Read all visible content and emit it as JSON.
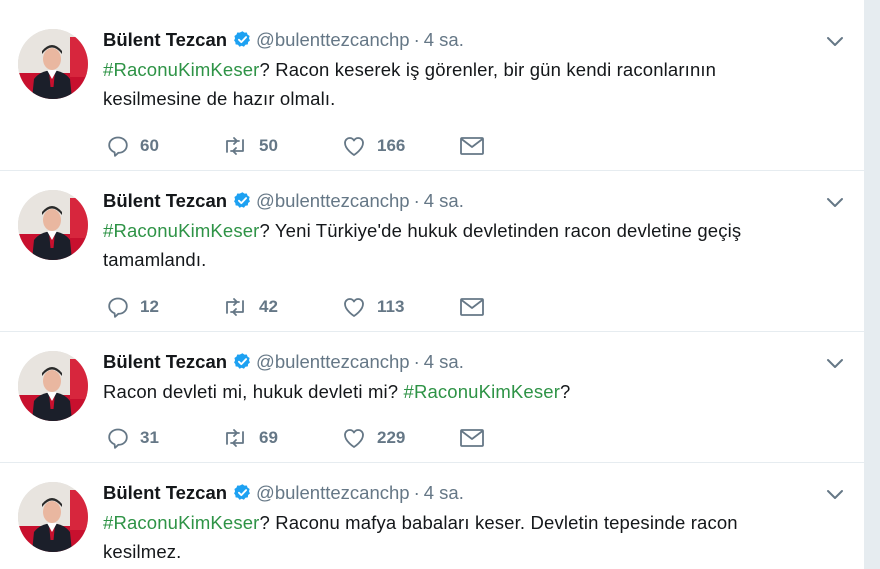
{
  "tweets": [
    {
      "name": "Bülent Tezcan",
      "handle": "@bulenttezcanchp",
      "separator": "·",
      "time": "4 sa.",
      "segments": [
        {
          "text": "#RaconuKimKeser",
          "hashtag": true
        },
        {
          "text": "? Racon keserek iş görenler, bir gün kendi raconlarının kesilmesine de hazır olmalı.",
          "hashtag": false
        }
      ],
      "replies": "60",
      "retweets": "50",
      "likes": "166"
    },
    {
      "name": "Bülent Tezcan",
      "handle": "@bulenttezcanchp",
      "separator": "·",
      "time": "4 sa.",
      "segments": [
        {
          "text": "#RaconuKimKeser",
          "hashtag": true
        },
        {
          "text": "? Yeni Türkiye'de hukuk devletinden racon devletine geçiş tamamlandı.",
          "hashtag": false
        }
      ],
      "replies": "12",
      "retweets": "42",
      "likes": "113"
    },
    {
      "name": "Bülent Tezcan",
      "handle": "@bulenttezcanchp",
      "separator": "·",
      "time": "4 sa.",
      "segments": [
        {
          "text": "Racon devleti mi, hukuk devleti mi? ",
          "hashtag": false
        },
        {
          "text": "#RaconuKimKeser",
          "hashtag": true
        },
        {
          "text": "?",
          "hashtag": false
        }
      ],
      "replies": "31",
      "retweets": "69",
      "likes": "229"
    },
    {
      "name": "Bülent Tezcan",
      "handle": "@bulenttezcanchp",
      "separator": "·",
      "time": "4 sa.",
      "segments": [
        {
          "text": "#RaconuKimKeser",
          "hashtag": true
        },
        {
          "text": "? Raconu mafya babaları keser. Devletin tepesinde racon kesilmez.",
          "hashtag": false
        }
      ]
    }
  ],
  "colors": {
    "hashtag": "#2e9346",
    "muted": "#657786",
    "verified": "#1da1f2",
    "text": "#14171a"
  },
  "icons": {
    "reply": "reply-icon",
    "retweet": "retweet-icon",
    "like": "heart-icon",
    "dm": "envelope-icon",
    "verified": "verified-badge-icon",
    "menu": "chevron-down-icon"
  }
}
